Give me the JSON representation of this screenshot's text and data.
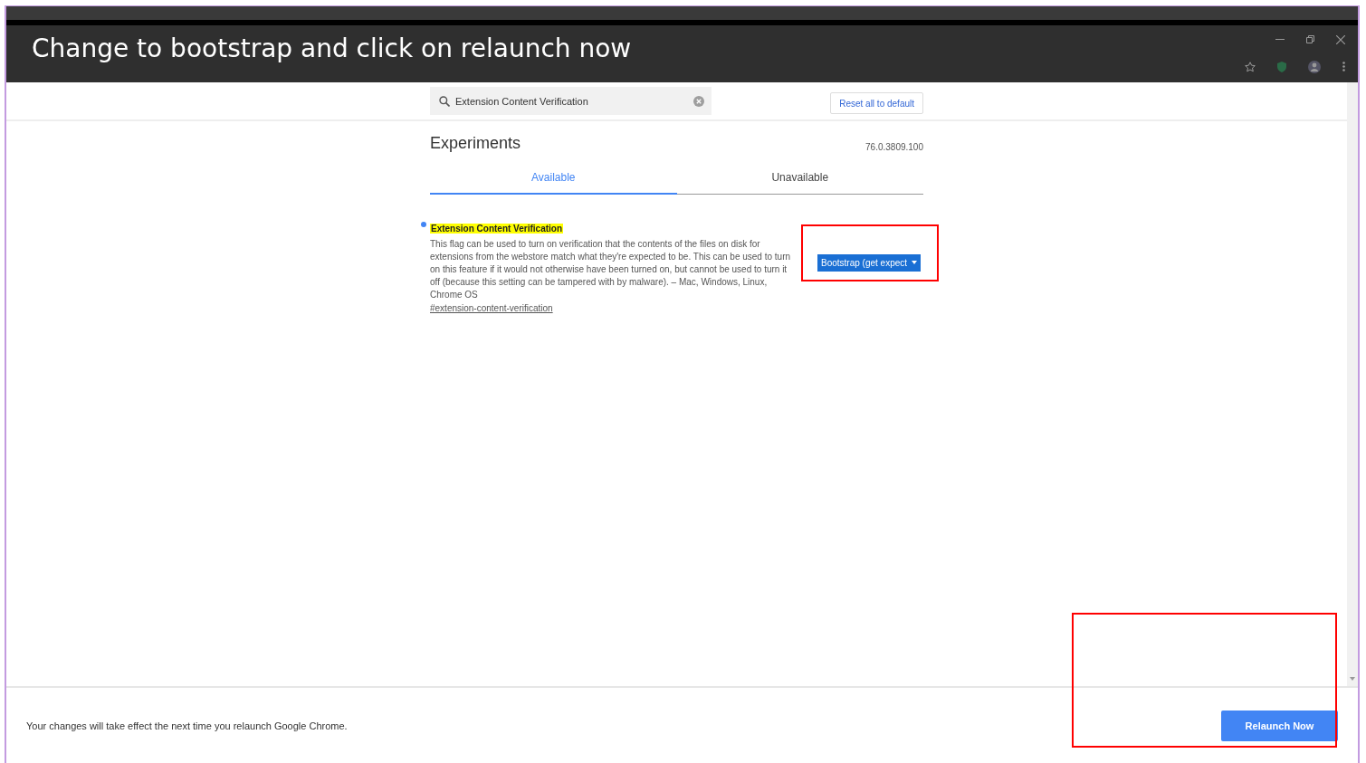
{
  "overlay_caption": "Change to bootstrap and click on relaunch now",
  "header": {
    "search": {
      "value": "Extension Content Verification"
    },
    "reset_button": "Reset all to default"
  },
  "title": "Experiments",
  "version": "76.0.3809.100",
  "tabs": [
    {
      "label": "Available",
      "selected": true
    },
    {
      "label": "Unavailable",
      "selected": false
    }
  ],
  "flags": [
    {
      "name": "Extension Content Verification",
      "highlighted": true,
      "modified": true,
      "description": "This flag can be used to turn on verification that the contents of the files on disk for extensions from the webstore match what they're expected to be. This can be used to turn on this feature if it would not otherwise have been turned on, but cannot be used to turn it off (because this setting can be tampered with by malware). – Mac, Windows, Linux, Chrome OS",
      "link": "#extension-content-verification",
      "dropdown": "Bootstrap (get expect"
    }
  ],
  "footer": {
    "message": "Your changes will take effect the next time you relaunch Google Chrome.",
    "button": "Relaunch Now"
  }
}
